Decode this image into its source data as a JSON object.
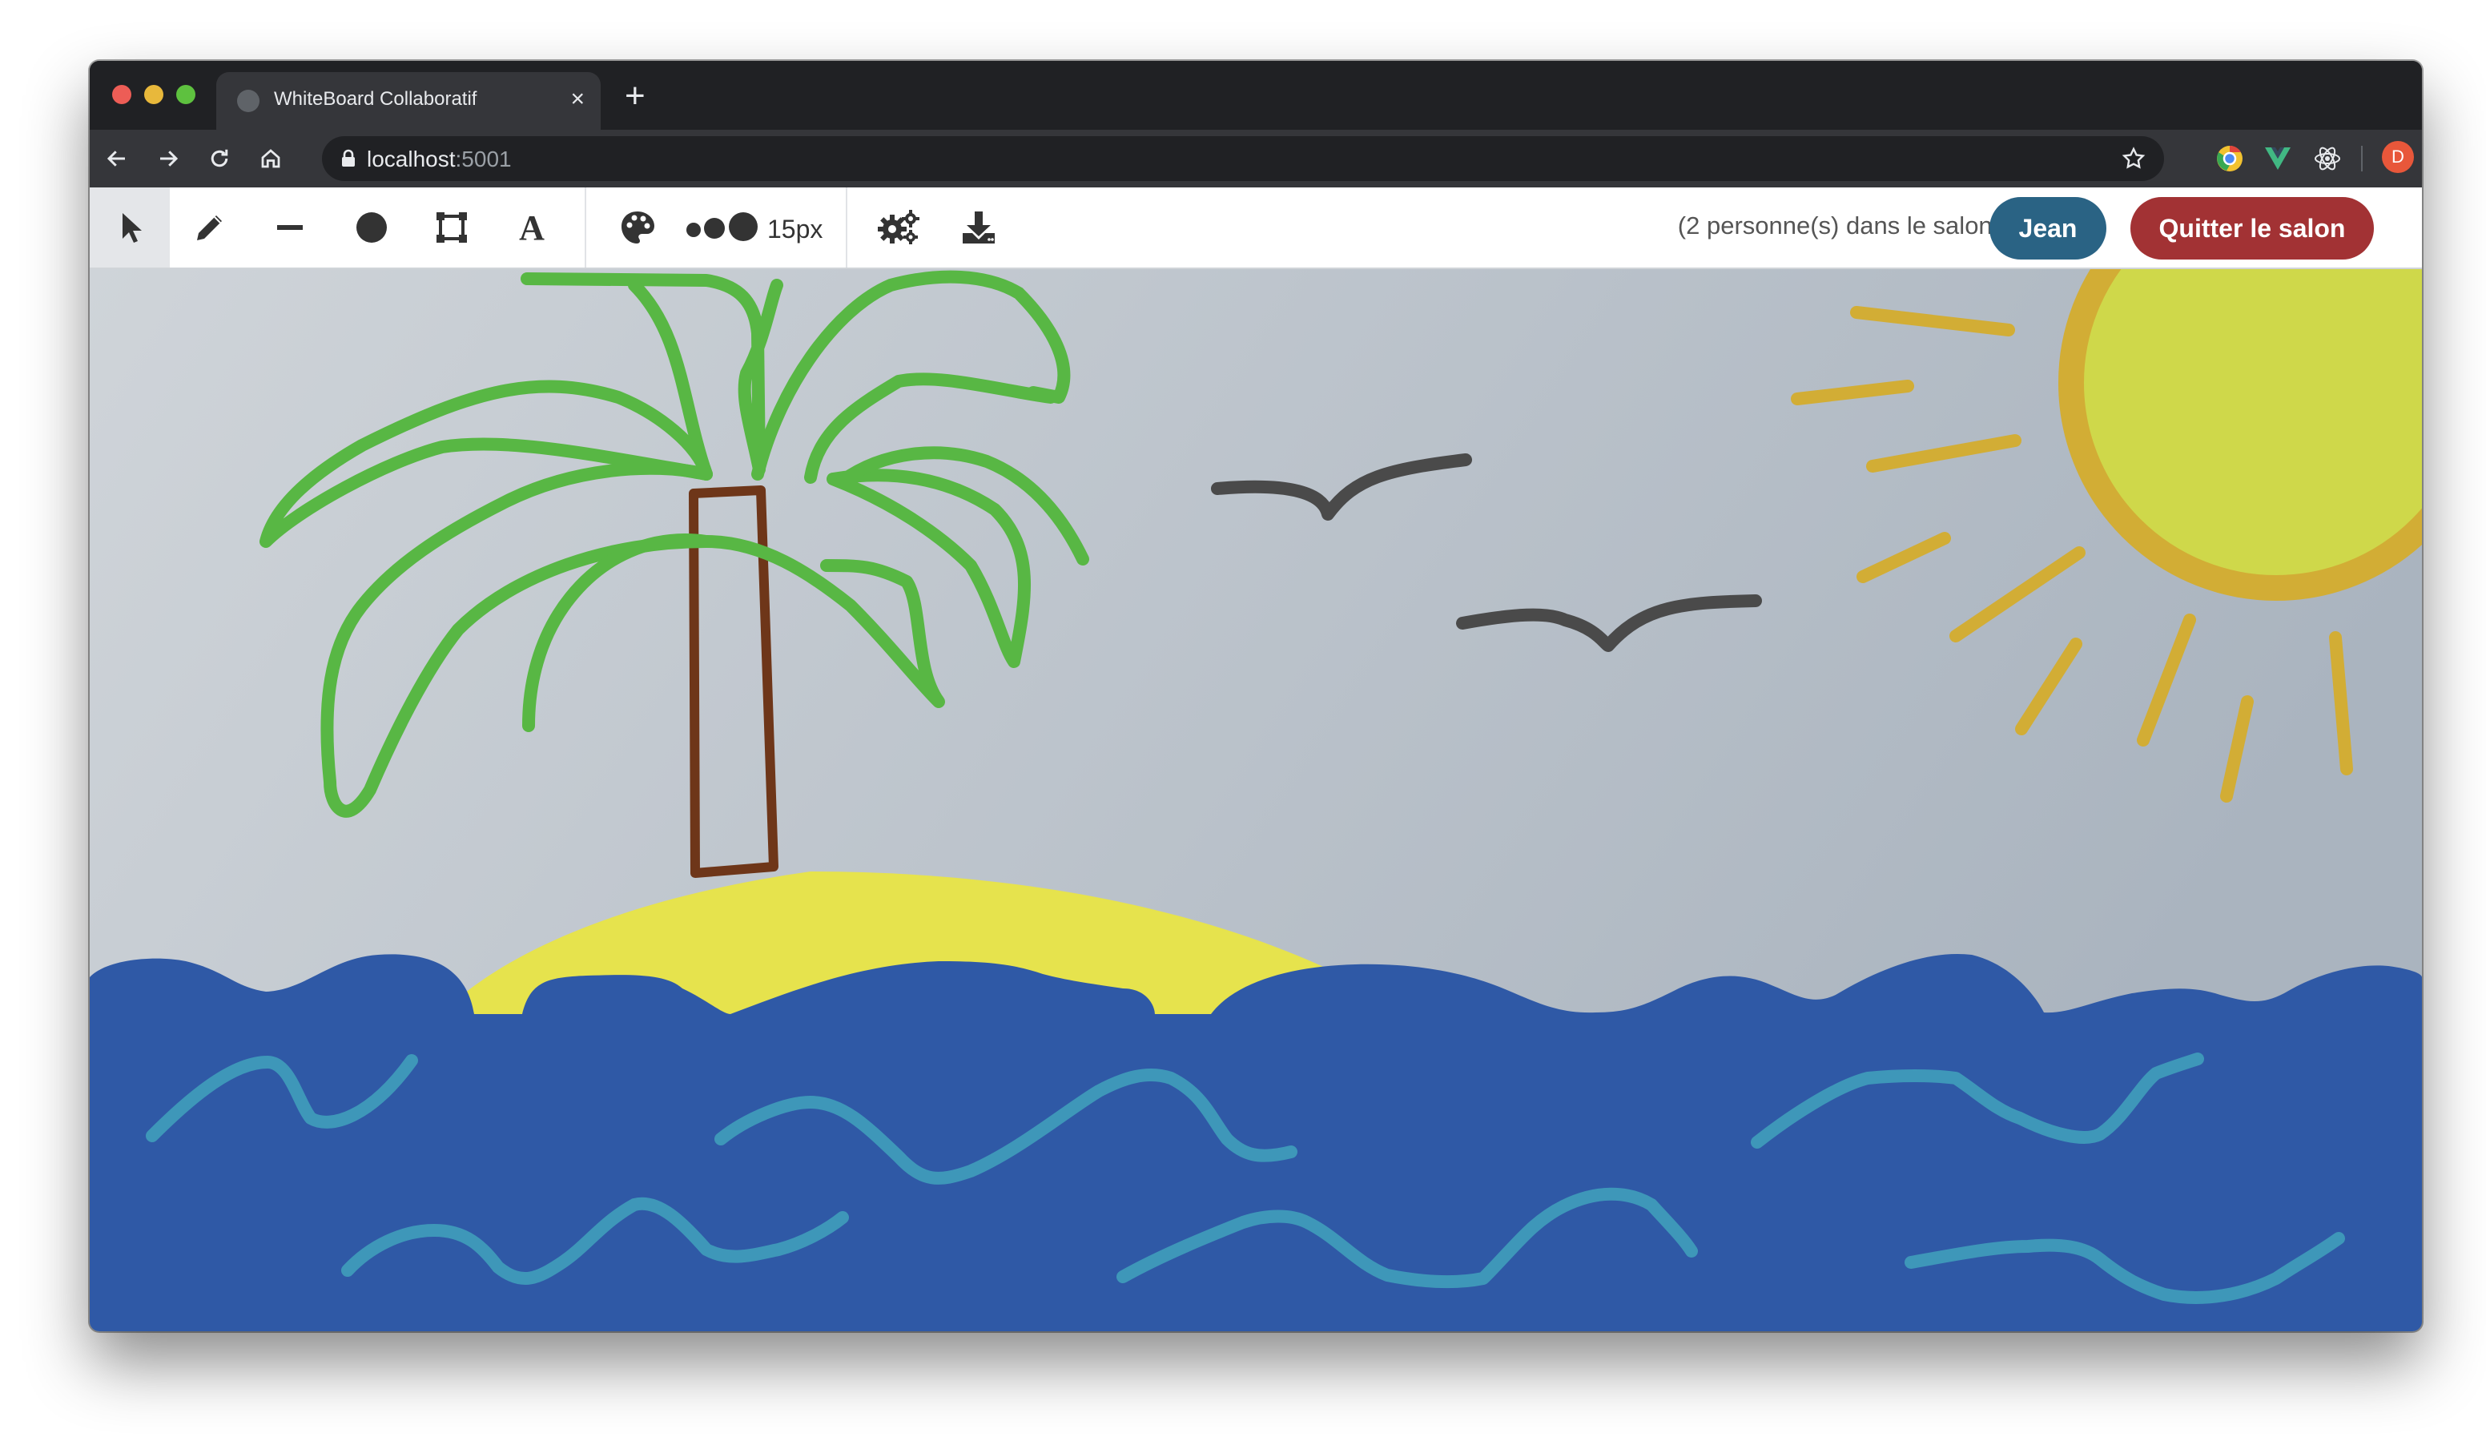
{
  "browser": {
    "tab_title": "WhiteBoard Collaboratif",
    "tab_close": "×",
    "new_tab": "+",
    "url_host": "localhost",
    "url_port": ":5001",
    "profile_initial": "D"
  },
  "toolbar": {
    "tools": [
      "select-tool",
      "pencil-tool",
      "line-tool",
      "circle-tool",
      "rectangle-tool",
      "text-tool",
      "color-tool",
      "size-tool",
      "settings-tool",
      "download-tool"
    ],
    "text_tool_glyph": "A",
    "size_label": "15px",
    "people_label": "(2 personne(s) dans le salon)",
    "user_button": "Jean",
    "quit_button": "Quitter le salon"
  },
  "colors": {
    "user_button": "#2a6384",
    "quit_button": "#a23234",
    "sky": "#c3c9d0",
    "sea": "#2f59a6",
    "waves": "#3e97b9",
    "sand": "#e6e34d",
    "sun": "#cfd84a",
    "sun_rim": "#d2ad35",
    "palm_leaves": "#58b744",
    "trunk": "#6e3619",
    "birds": "#4a4a4a"
  }
}
